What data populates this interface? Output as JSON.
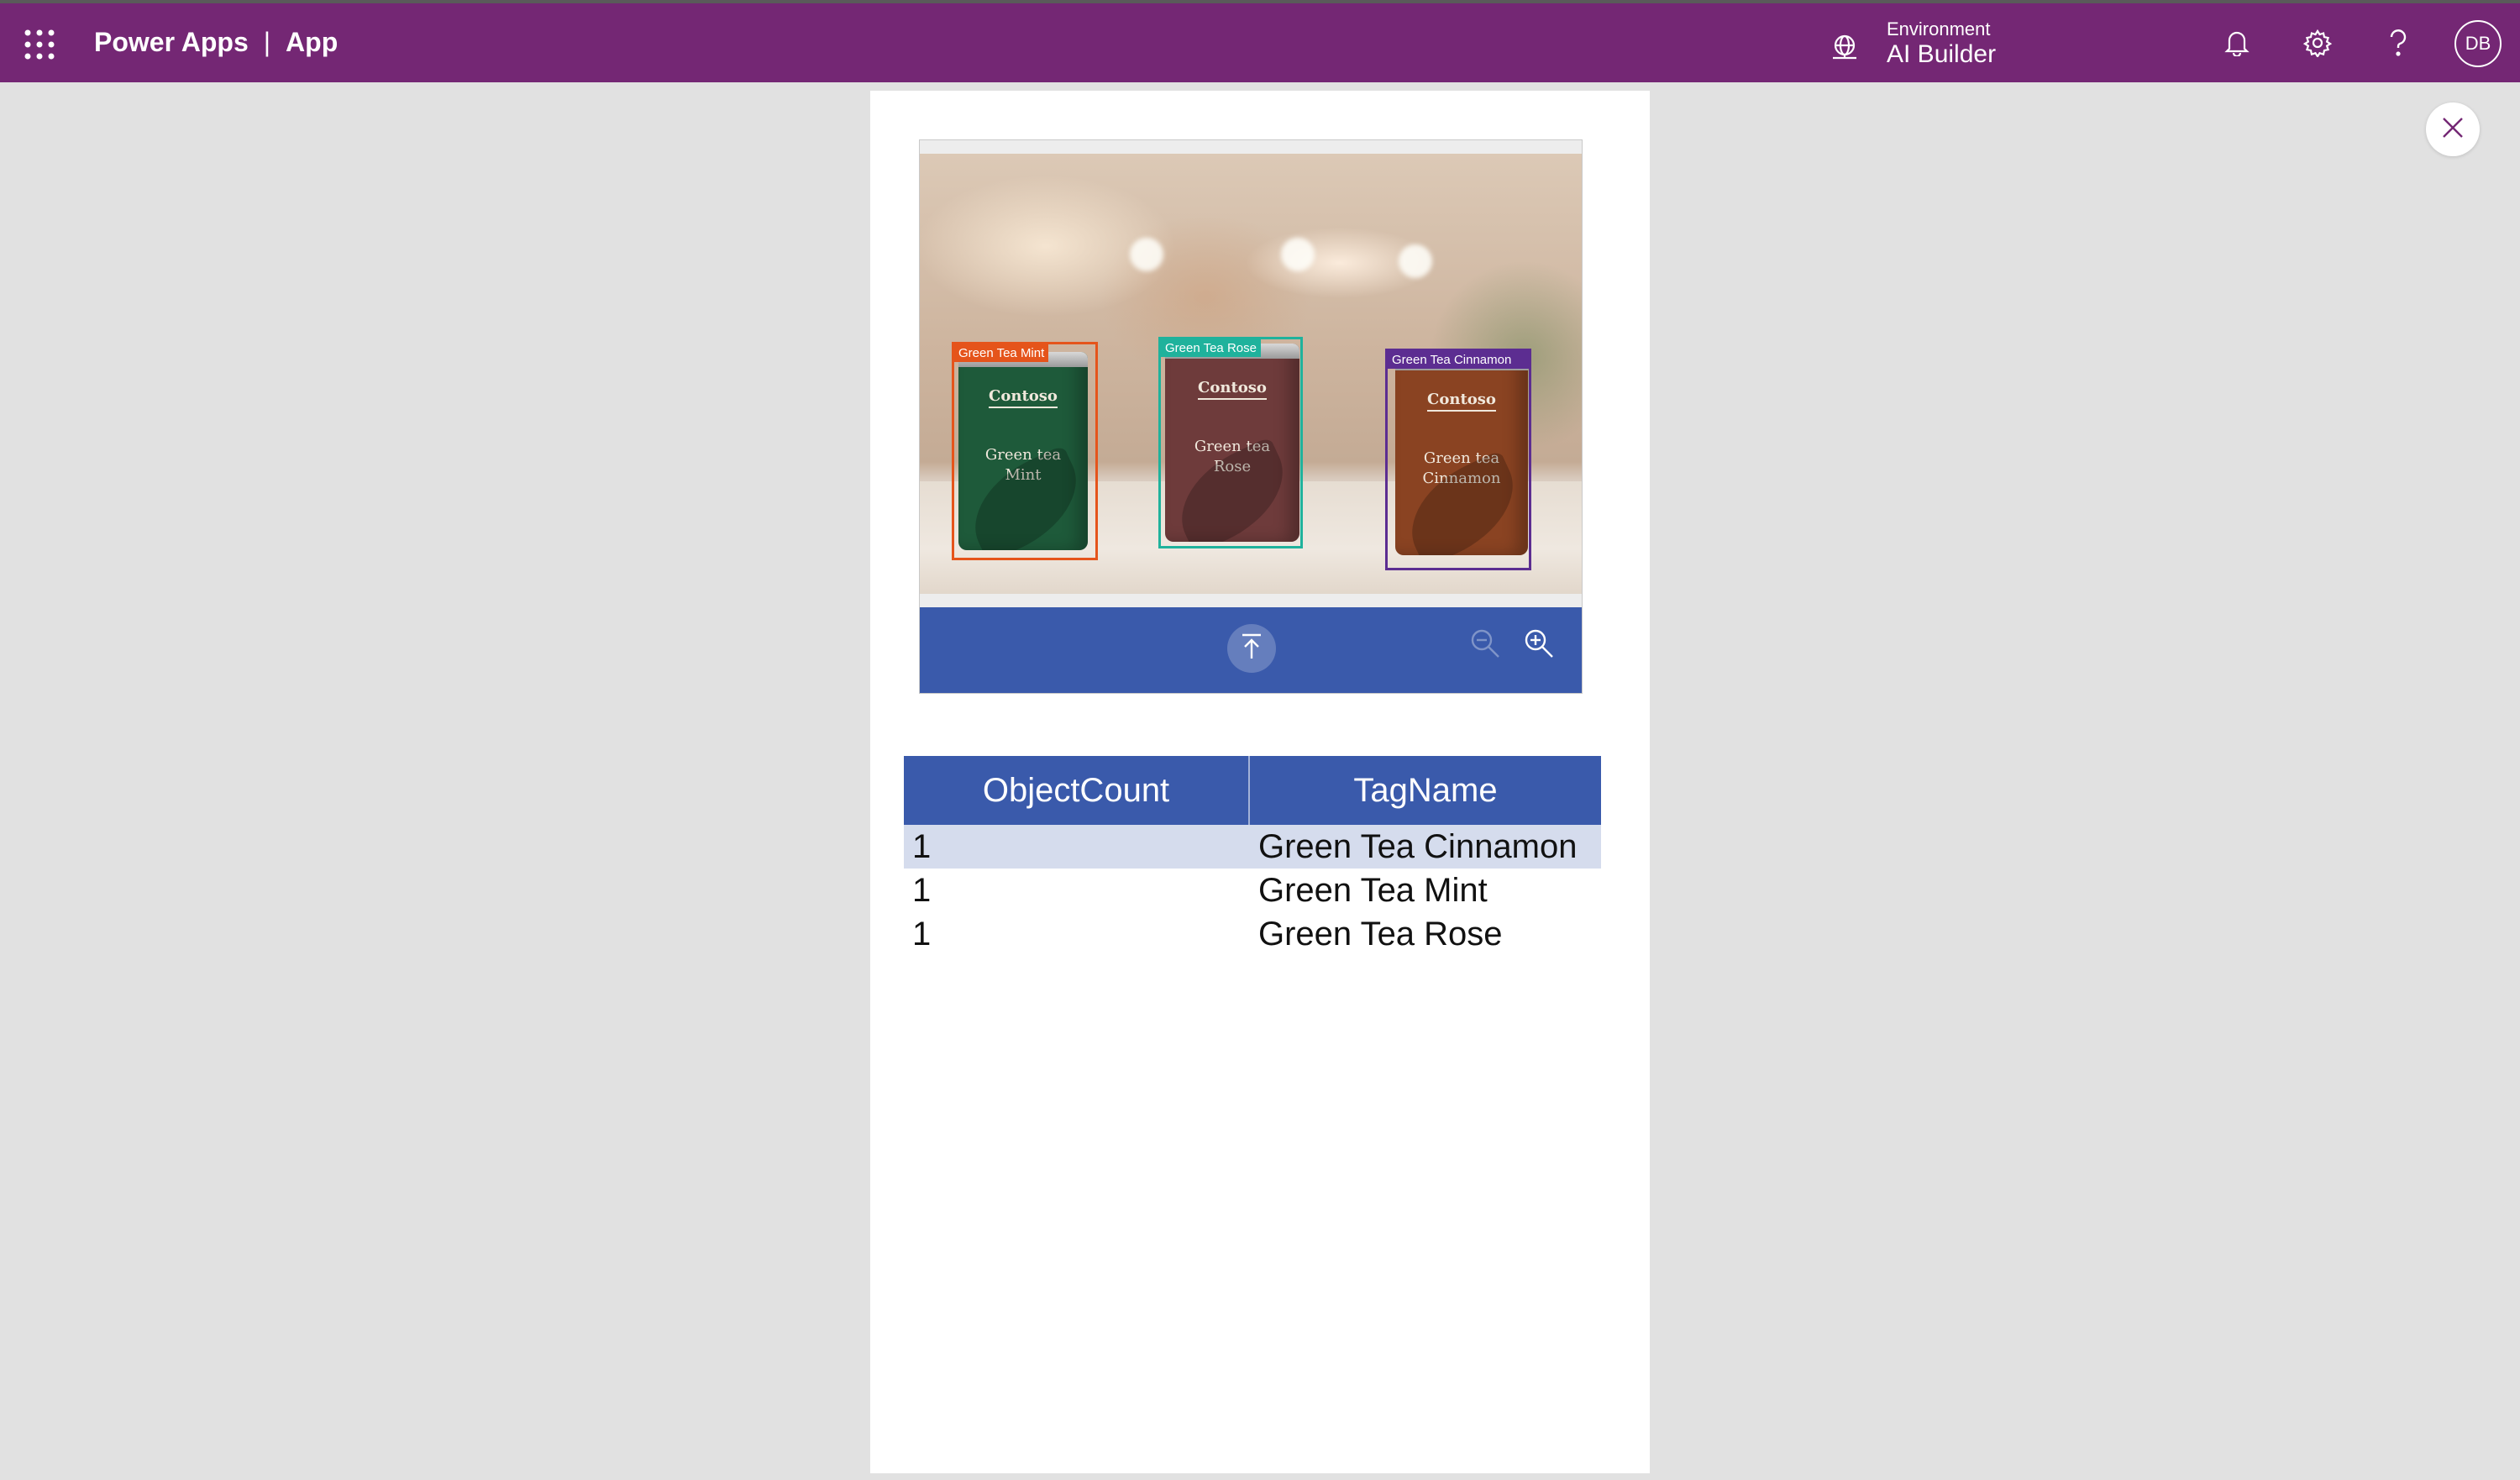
{
  "header": {
    "product": "Power Apps",
    "separator": "|",
    "app": "App",
    "environment_caption": "Environment",
    "environment_name": "AI Builder",
    "avatar_initials": "DB",
    "icons": [
      "waffle-icon",
      "environment-icon",
      "bell-icon",
      "gear-icon",
      "help-icon"
    ],
    "bar_color": "#742774"
  },
  "image_control": {
    "cans": [
      {
        "brand": "Contoso",
        "flavor_line1": "Green tea",
        "flavor_line2": "Mint"
      },
      {
        "brand": "Contoso",
        "flavor_line1": "Green tea",
        "flavor_line2": "Rose"
      },
      {
        "brand": "Contoso",
        "flavor_line1": "Green tea",
        "flavor_line2": "Cinnamon"
      }
    ],
    "detections": [
      {
        "label": "Green Tea Mint",
        "color": "#e5541b"
      },
      {
        "label": "Green Tea Rose",
        "color": "#1fb29c"
      },
      {
        "label": "Green Tea Cinnamon",
        "color": "#5c2d91"
      }
    ],
    "toolbar_color": "#3a5aab",
    "toolbar_icons": [
      "upload-icon",
      "zoom-out-icon",
      "zoom-in-icon"
    ]
  },
  "results_table": {
    "columns": [
      "ObjectCount",
      "TagName"
    ],
    "rows": [
      {
        "count": "1",
        "tag": "Green Tea Cinnamon"
      },
      {
        "count": "1",
        "tag": "Green Tea Mint"
      },
      {
        "count": "1",
        "tag": "Green Tea Rose"
      }
    ]
  }
}
